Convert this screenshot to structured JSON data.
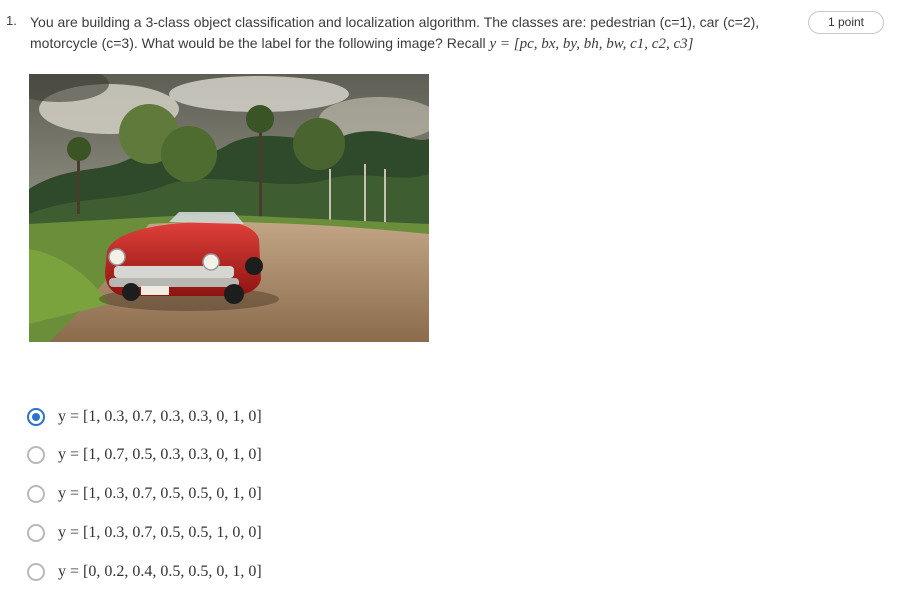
{
  "question": {
    "number": "1.",
    "text": "You are building a 3-class object classification and localization algorithm. The classes are: pedestrian (c=1), car (c=2), motorcycle (c=3). What would be the label for the following image? Recall",
    "recall_formula": "y = [pc, bx, by, bh, bw, c1, c2, c3]",
    "points": "1 point"
  },
  "image": {
    "description": "red vintage convertible car parked on a dirt road with palm trees and cloudy sky"
  },
  "options": [
    {
      "label": "y = [1, 0.3, 0.7, 0.3, 0.3, 0, 1, 0]",
      "selected": true
    },
    {
      "label": "y = [1, 0.7, 0.5, 0.3, 0.3, 0, 1, 0]",
      "selected": false
    },
    {
      "label": "y = [1, 0.3, 0.7, 0.5, 0.5, 0, 1, 0]",
      "selected": false
    },
    {
      "label": "y = [1, 0.3, 0.7, 0.5, 0.5, 1, 0, 0]",
      "selected": false
    },
    {
      "label": "y = [0, 0.2, 0.4, 0.5, 0.5, 0, 1, 0]",
      "selected": false
    }
  ],
  "colors": {
    "accent": "#2a73cc",
    "radio_border": "#b9b9b9",
    "text": "#3c3c3c"
  }
}
